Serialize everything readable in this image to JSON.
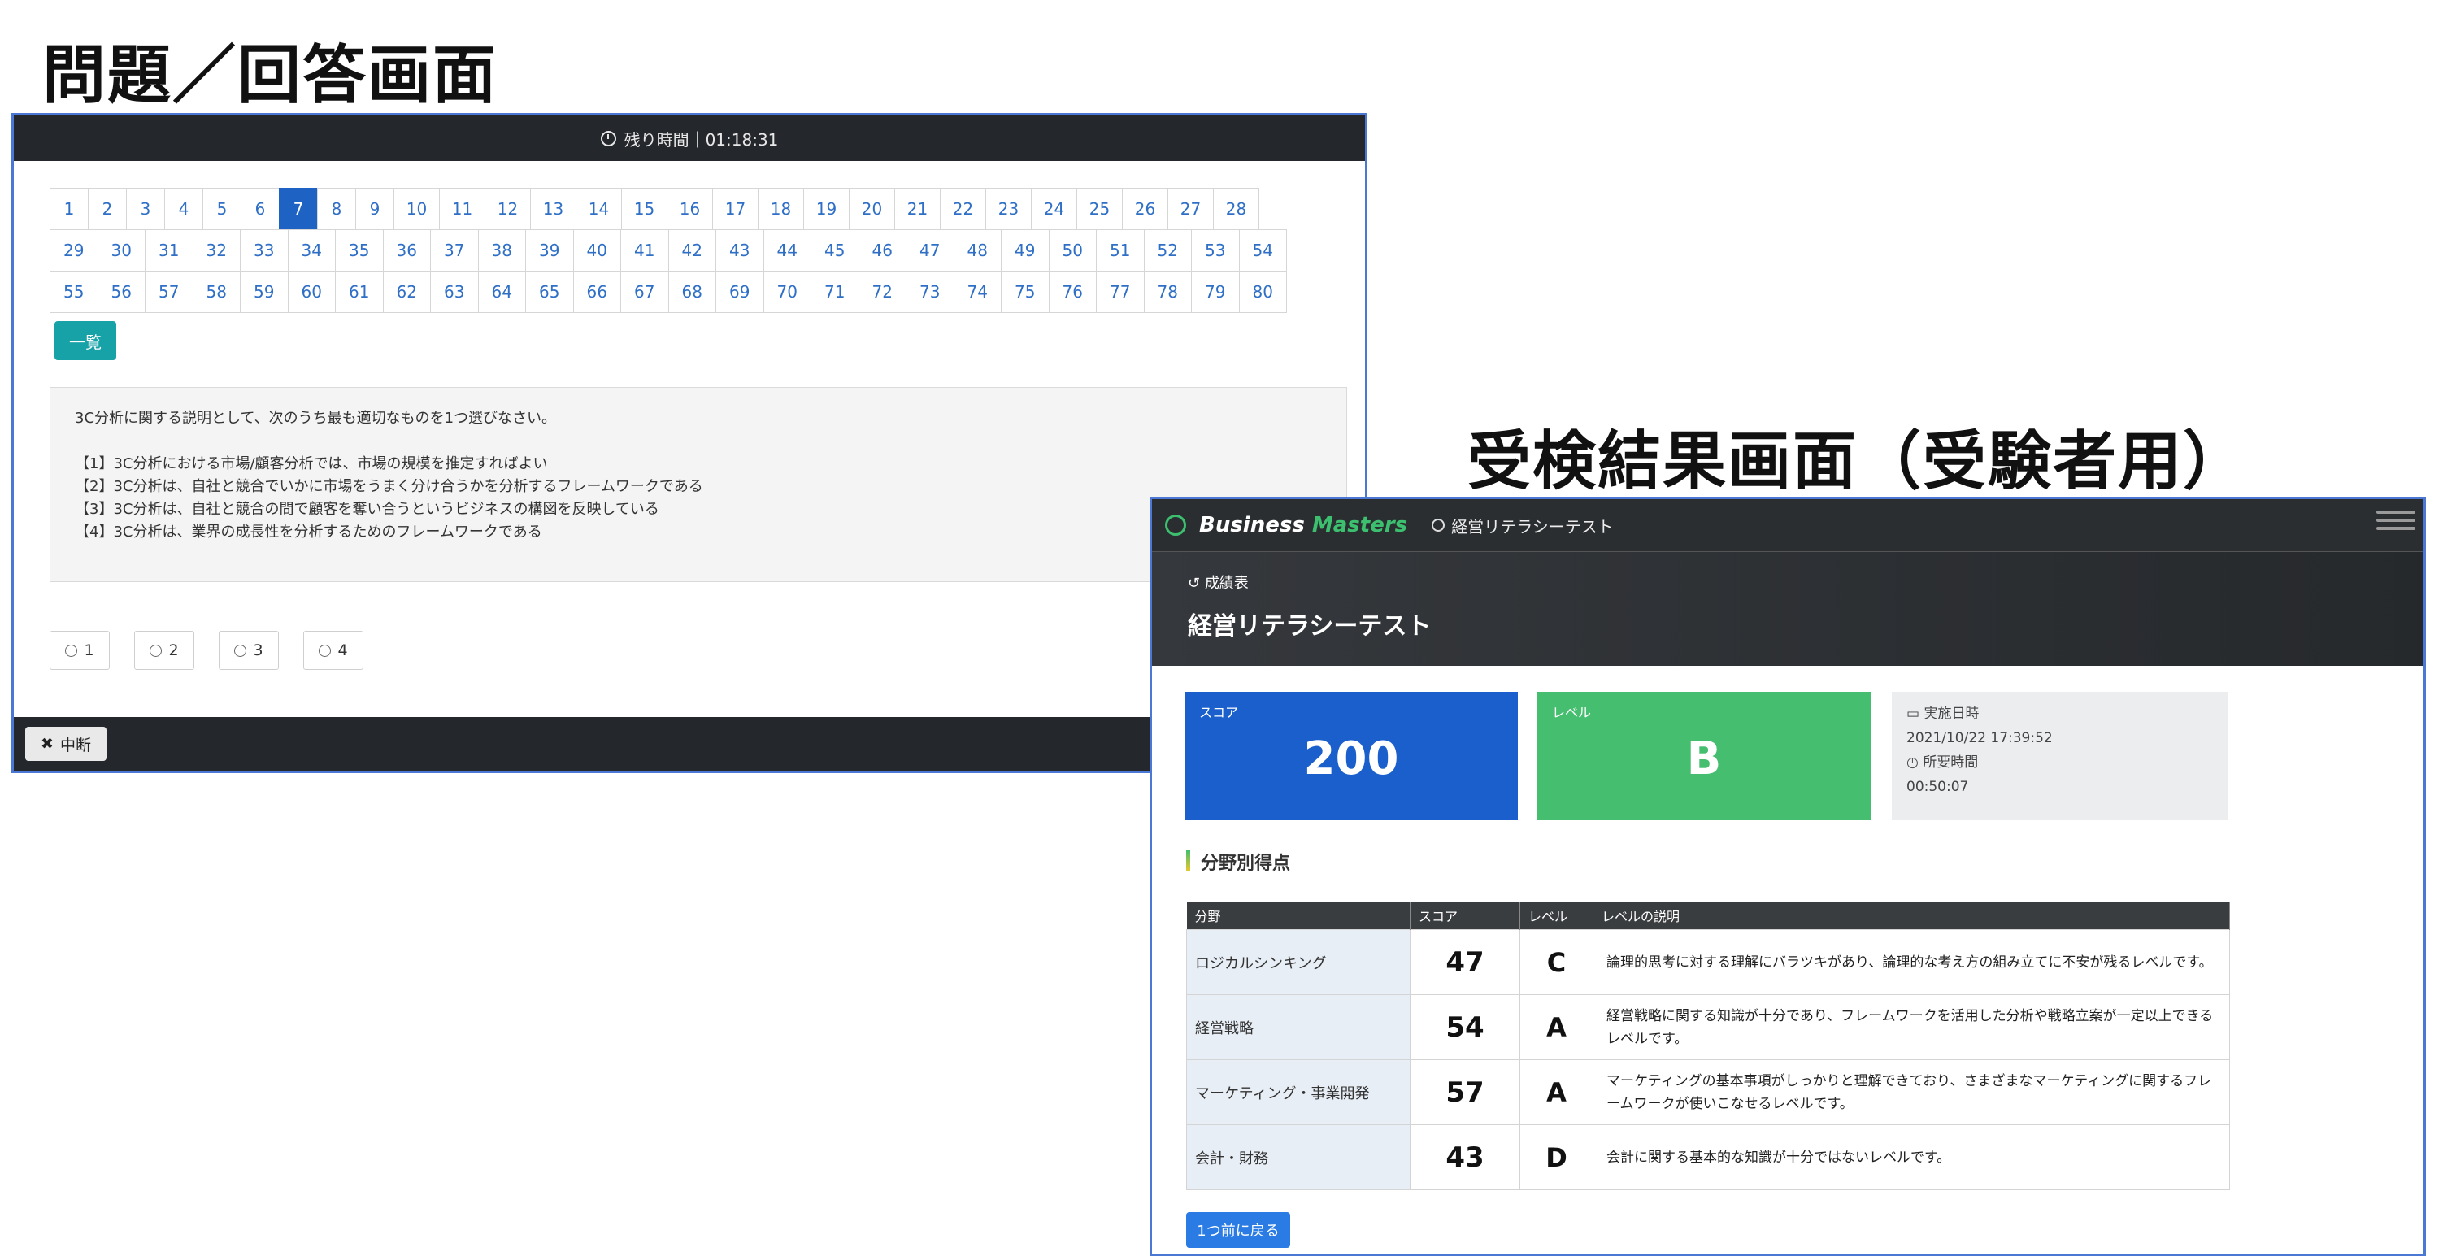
{
  "headings": {
    "quiz": "問題／回答画面",
    "result": "受検結果画面（受験者用）"
  },
  "quiz": {
    "timer_label": "残り時間｜01:18:31",
    "question_numbers": [
      [
        "1",
        "2",
        "3",
        "4",
        "5",
        "6",
        "7",
        "8",
        "9",
        "10",
        "11",
        "12",
        "13",
        "14",
        "15",
        "16",
        "17",
        "18",
        "19",
        "20",
        "21",
        "22",
        "23",
        "24",
        "25",
        "26",
        "27",
        "28"
      ],
      [
        "29",
        "30",
        "31",
        "32",
        "33",
        "34",
        "35",
        "36",
        "37",
        "38",
        "39",
        "40",
        "41",
        "42",
        "43",
        "44",
        "45",
        "46",
        "47",
        "48",
        "49",
        "50",
        "51",
        "52",
        "53",
        "54"
      ],
      [
        "55",
        "56",
        "57",
        "58",
        "59",
        "60",
        "61",
        "62",
        "63",
        "64",
        "65",
        "66",
        "67",
        "68",
        "69",
        "70",
        "71",
        "72",
        "73",
        "74",
        "75",
        "76",
        "77",
        "78",
        "79",
        "80"
      ]
    ],
    "active_question": "7",
    "list_button": "一覧",
    "question": "3C分析に関する説明として、次のうち最も適切なものを1つ選びなさい。",
    "choices": [
      "【1】3C分析における市場/顧客分析では、市場の規模を推定すればよい",
      "【2】3C分析は、自社と競合でいかに市場をうまく分け合うかを分析するフレームワークである",
      "【3】3C分析は、自社と競合の間で顧客を奪い合うというビジネスの構図を反映している",
      "【4】3C分析は、業界の成長性を分析するためのフレームワークである"
    ],
    "answers": [
      "1",
      "2",
      "3",
      "4"
    ],
    "stop_button": "中断",
    "accent": "#1e63c4"
  },
  "result": {
    "brand_primary": "Business",
    "brand_secondary": "Masters",
    "nav_title": "経営リテラシーテスト",
    "subheader": "成績表",
    "test_name": "経営リテラシーテスト",
    "score_label": "スコア",
    "score_value": "200",
    "level_label": "レベル",
    "level_value": "B",
    "date_label": "実施日時",
    "date_value": "2021/10/22 17:39:52",
    "duration_label": "所要時間",
    "duration_value": "00:50:07",
    "section_title": "分野別得点",
    "table_headers": [
      "分野",
      "スコア",
      "レベル",
      "レベルの説明"
    ],
    "rows": [
      {
        "field": "ロジカルシンキング",
        "score": "47",
        "level": "C",
        "desc": "論理的思考に対する理解にバラツキがあり、論理的な考え方の組み立てに不安が残るレベルです。"
      },
      {
        "field": "経営戦略",
        "score": "54",
        "level": "A",
        "desc": "経営戦略に関する知識が十分であり、フレームワークを活用した分析や戦略立案が一定以上できるレベルです。"
      },
      {
        "field": "マーケティング・事業開発",
        "score": "57",
        "level": "A",
        "desc": "マーケティングの基本事項がしっかりと理解できており、さまざまなマーケティングに関するフレームワークが使いこなせるレベルです。"
      },
      {
        "field": "会計・財務",
        "score": "43",
        "level": "D",
        "desc": "会計に関する基本的な知識が十分ではないレベルです。"
      }
    ],
    "back_button": "1つ前に戻る",
    "score_color": "#1a5fcb",
    "level_color": "#46be6f"
  }
}
